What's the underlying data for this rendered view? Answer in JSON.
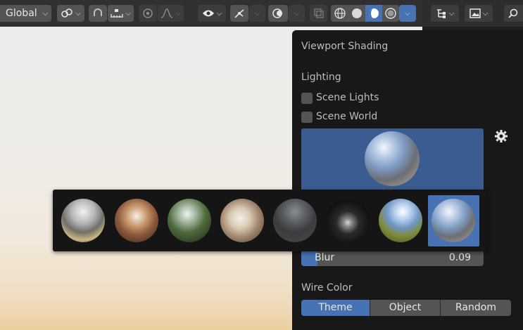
{
  "header": {
    "orientation_label": "Global",
    "icons": [
      "link-icon",
      "snap-icon",
      "increment-icon",
      "proportional-icon",
      "falloff-icon",
      "visibility-icon",
      "gizmo-icon",
      "overlay-icon",
      "xray-icon",
      "wireframe-shading-icon",
      "solid-shading-icon",
      "material-preview-icon",
      "rendered-shading-icon",
      "shading-options-icon"
    ]
  },
  "right_panel": {
    "icons": [
      "outliner-filter-icon",
      "image-icon",
      "search-icon"
    ]
  },
  "popover": {
    "title": "Viewport Shading",
    "lighting_label": "Lighting",
    "scene_lights": {
      "label": "Scene Lights",
      "checked": false
    },
    "scene_world": {
      "label": "Scene World",
      "checked": false
    },
    "blur": {
      "label": "Blur",
      "value": "0.09",
      "fraction": 0.09
    },
    "wire_color": {
      "label": "Wire Color",
      "options": [
        "Theme",
        "Object",
        "Random"
      ],
      "selected": "Theme"
    }
  },
  "hdri_picker": {
    "items": [
      "city",
      "courtyard",
      "forest",
      "interior",
      "night",
      "studio",
      "sunrise",
      "sunset"
    ],
    "selected_index": 7
  },
  "colors": {
    "accent": "#4772b3",
    "popover_bg": "#181818",
    "button_bg": "#545454"
  }
}
